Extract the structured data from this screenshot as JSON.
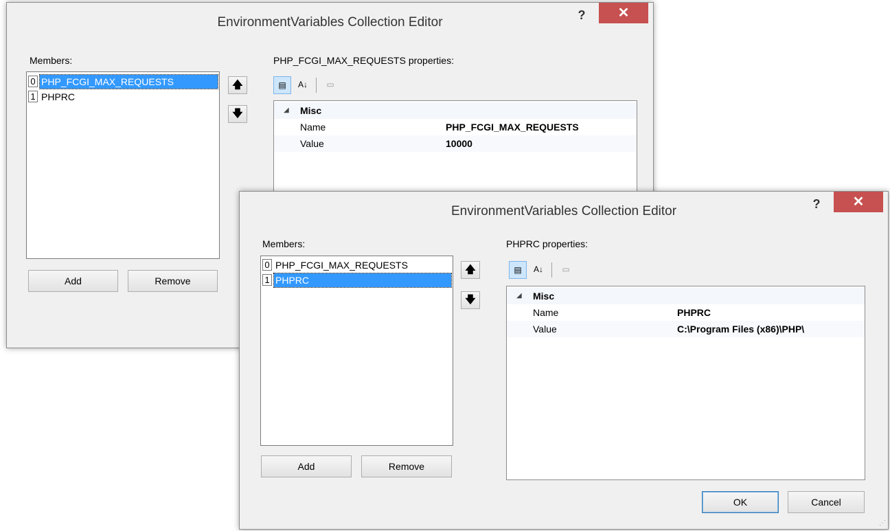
{
  "dialogs": [
    {
      "title": "EnvironmentVariables Collection Editor",
      "help": "?",
      "close": "✕",
      "members_label": "Members:",
      "members": [
        {
          "index": "0",
          "name": "PHP_FCGI_MAX_REQUESTS",
          "selected": true
        },
        {
          "index": "1",
          "name": "PHPRC",
          "selected": false
        }
      ],
      "properties_label": "PHP_FCGI_MAX_REQUESTS properties:",
      "category": "Misc",
      "props": [
        {
          "name": "Name",
          "value": "PHP_FCGI_MAX_REQUESTS"
        },
        {
          "name": "Value",
          "value": "10000"
        }
      ],
      "add_label": "Add",
      "remove_label": "Remove"
    },
    {
      "title": "EnvironmentVariables Collection Editor",
      "help": "?",
      "close": "✕",
      "members_label": "Members:",
      "members": [
        {
          "index": "0",
          "name": "PHP_FCGI_MAX_REQUESTS",
          "selected": false
        },
        {
          "index": "1",
          "name": "PHPRC",
          "selected": true
        }
      ],
      "properties_label": "PHPRC properties:",
      "category": "Misc",
      "props": [
        {
          "name": "Name",
          "value": "PHPRC"
        },
        {
          "name": "Value",
          "value": "C:\\Program Files (x86)\\PHP\\"
        }
      ],
      "add_label": "Add",
      "remove_label": "Remove",
      "ok_label": "OK",
      "cancel_label": "Cancel"
    }
  ],
  "icons": {
    "up": "🡅",
    "down": "🡇",
    "categorized": "▤",
    "alpha": "A↓",
    "pages": "▭",
    "expanded": "◢"
  }
}
